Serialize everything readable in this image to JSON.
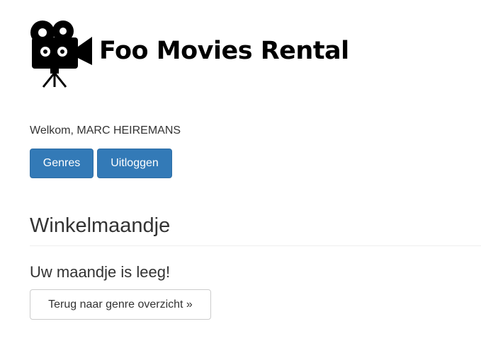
{
  "header": {
    "logo_icon": "movie-camera-icon",
    "title": "Foo Movies Rental"
  },
  "user": {
    "welcome": "Welkom, MARC HEIREMANS"
  },
  "actions": {
    "genres_label": "Genres",
    "logout_label": "Uitloggen",
    "primary_color": "#337ab7"
  },
  "cart": {
    "title": "Winkelmaandje",
    "empty_message": "Uw maandje is leeg!",
    "back_label": "Terug naar genre overzicht »"
  }
}
